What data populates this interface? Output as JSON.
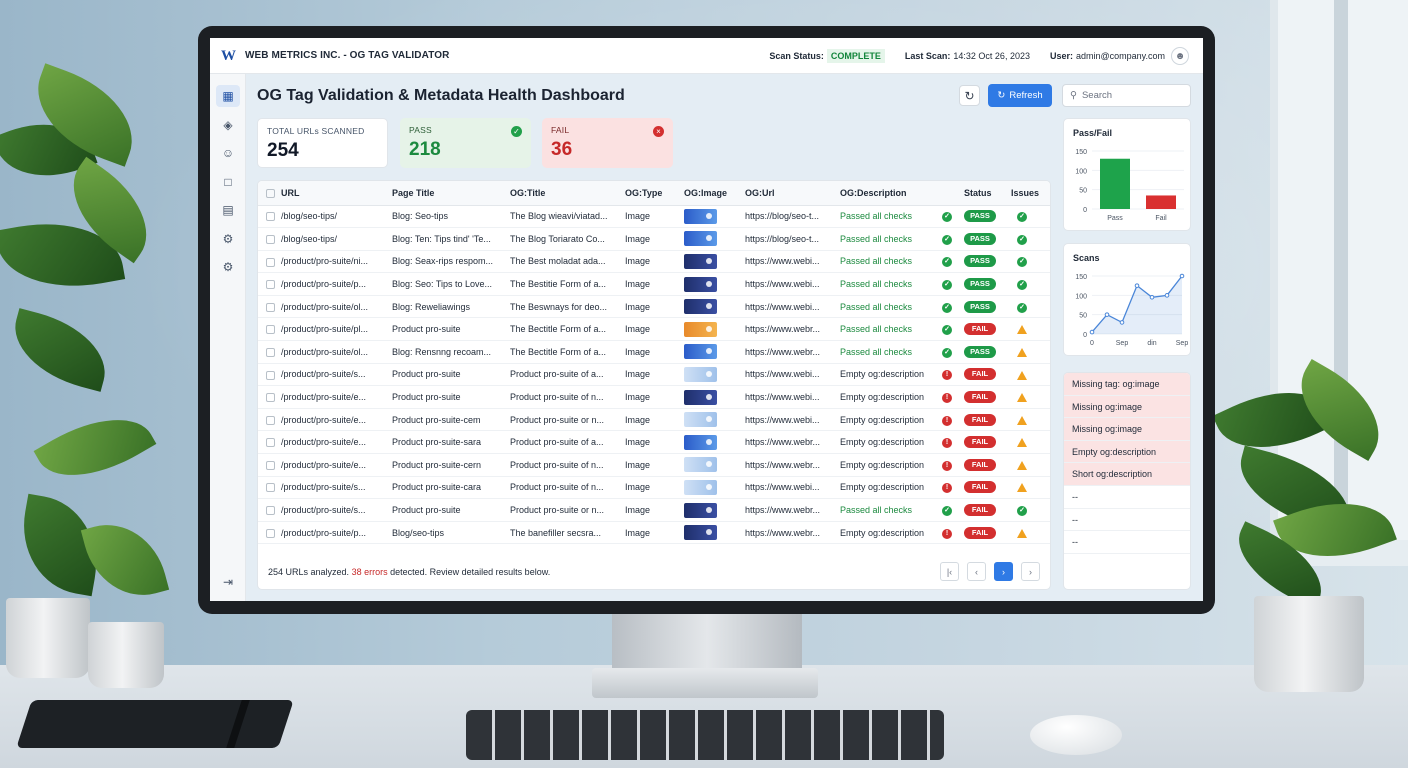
{
  "app": {
    "title": "WEB METRICS INC. - OG TAG VALIDATOR",
    "scan_status_label": "Scan Status:",
    "scan_status_value": "COMPLETE",
    "last_scan_label": "Last Scan:",
    "last_scan_value": "14:32 Oct 26, 2023",
    "user_label": "User:",
    "user_value": "admin@company.com"
  },
  "page": {
    "title": "OG Tag Validation & Metadata Health Dashboard",
    "refresh_label": "Refresh",
    "search_placeholder": "Search"
  },
  "kpis": {
    "total": {
      "label": "TOTAL URLs SCANNED",
      "value": "254"
    },
    "pass": {
      "label": "PASS",
      "value": "218"
    },
    "fail": {
      "label": "FAIL",
      "value": "36"
    }
  },
  "table": {
    "columns": [
      "URL",
      "Page Title",
      "OG:Title",
      "OG:Type",
      "OG:Image",
      "OG:Url",
      "OG:Description",
      "Status",
      "Issues"
    ],
    "rows": [
      {
        "url": "/blog/seo-tips/",
        "page_title": "Blog: Seo-tips",
        "og_title": "The Blog wieavi/viatad...",
        "og_type": "Image",
        "thumb": "blue",
        "og_url": "https://blog/seo-t...",
        "og_desc": "Passed all checks",
        "desc_ok": true,
        "status": "PASS",
        "issue": "ok"
      },
      {
        "url": "/blog/seo-tips/",
        "page_title": "Blog: Ten: Tips tind' 'Te...",
        "og_title": "The Blog Toriarato Co...",
        "og_type": "Image",
        "thumb": "blue",
        "og_url": "https://blog/seo-t...",
        "og_desc": "Passed all checks",
        "desc_ok": true,
        "status": "PASS",
        "issue": "ok"
      },
      {
        "url": "/product/pro-suite/ni...",
        "page_title": "Blog: Seax-rips respom...",
        "og_title": "The Best moladat ada...",
        "og_type": "Image",
        "thumb": "navy",
        "og_url": "https://www.webi...",
        "og_desc": "Passed all checks",
        "desc_ok": true,
        "status": "PASS",
        "issue": "ok"
      },
      {
        "url": "/product/pro-suite/p...",
        "page_title": "Blog: Seo: Tips to Love...",
        "og_title": "The Bestitie Form of a...",
        "og_type": "Image",
        "thumb": "navy",
        "og_url": "https://www.webi...",
        "og_desc": "Passed all checks",
        "desc_ok": true,
        "status": "PASS",
        "issue": "ok"
      },
      {
        "url": "/product/pro-suite/ol...",
        "page_title": "Blog: Reweliawings",
        "og_title": "The Beswnays for deo...",
        "og_type": "Image",
        "thumb": "navy",
        "og_url": "https://www.webi...",
        "og_desc": "Passed all checks",
        "desc_ok": true,
        "status": "PASS",
        "issue": "ok"
      },
      {
        "url": "/product/pro-suite/pl...",
        "page_title": "Product pro-suite",
        "og_title": "The Bectitle Form of a...",
        "og_type": "Image",
        "thumb": "orange",
        "og_url": "https://www.webr...",
        "og_desc": "Passed all checks",
        "desc_ok": true,
        "status": "FAIL",
        "issue": "warn"
      },
      {
        "url": "/product/pro-suite/ol...",
        "page_title": "Blog: Rensnng recoam...",
        "og_title": "The Bectitle Form of a...",
        "og_type": "Image",
        "thumb": "blue",
        "og_url": "https://www.webr...",
        "og_desc": "Passed all checks",
        "desc_ok": true,
        "status": "PASS",
        "issue": "warn"
      },
      {
        "url": "/product/pro-suite/s...",
        "page_title": "Product pro-suite",
        "og_title": "Product pro-suite of a...",
        "og_type": "Image",
        "thumb": "light",
        "og_url": "https://www.webi...",
        "og_desc": "Empty og:description",
        "desc_ok": false,
        "status": "FAIL",
        "issue": "warn"
      },
      {
        "url": "/product/pro-suite/e...",
        "page_title": "Product pro-suite",
        "og_title": "Product pro-suite of n...",
        "og_type": "Image",
        "thumb": "navy",
        "og_url": "https://www.webi...",
        "og_desc": "Empty og:description",
        "desc_ok": false,
        "status": "FAIL",
        "issue": "warn"
      },
      {
        "url": "/product/pro-suite/e...",
        "page_title": "Product pro-suite-cem",
        "og_title": "Product pro-suite or n...",
        "og_type": "Image",
        "thumb": "light",
        "og_url": "https://www.webi...",
        "og_desc": "Empty og:description",
        "desc_ok": false,
        "status": "FAIL",
        "issue": "warn"
      },
      {
        "url": "/product/pro-suite/e...",
        "page_title": "Product pro-suite-sara",
        "og_title": "Product pro-suite of a...",
        "og_type": "Image",
        "thumb": "blue",
        "og_url": "https://www.webr...",
        "og_desc": "Empty og:description",
        "desc_ok": false,
        "status": "FAIL",
        "issue": "warn"
      },
      {
        "url": "/product/pro-suite/e...",
        "page_title": "Product pro-suite-cern",
        "og_title": "Product pro-suite of n...",
        "og_type": "Image",
        "thumb": "light",
        "og_url": "https://www.webr...",
        "og_desc": "Empty og:description",
        "desc_ok": false,
        "status": "FAIL",
        "issue": "warn"
      },
      {
        "url": "/product/pro-suite/s...",
        "page_title": "Product pro-suite-cara",
        "og_title": "Product pro-suite of n...",
        "og_type": "Image",
        "thumb": "light",
        "og_url": "https://www.webi...",
        "og_desc": "Empty og:description",
        "desc_ok": false,
        "status": "FAIL",
        "issue": "warn"
      },
      {
        "url": "/product/pro-suite/s...",
        "page_title": "Product pro-suite",
        "og_title": "Product pro-suite or n...",
        "og_type": "Image",
        "thumb": "navy",
        "og_url": "https://www.webr...",
        "og_desc": "Passed all checks",
        "desc_ok": true,
        "status": "FAIL",
        "issue": "ok"
      },
      {
        "url": "/product/pro-suite/p...",
        "page_title": "Blog/seo-tips",
        "og_title": "The banefiller secsra...",
        "og_type": "Image",
        "thumb": "navy",
        "og_url": "https://www.webr...",
        "og_desc": "Empty og:description",
        "desc_ok": false,
        "status": "FAIL",
        "issue": "warn"
      }
    ]
  },
  "footer": {
    "analyzed": "254 URLs analyzed.",
    "errors": "38 errors",
    "rest": "detected. Review detailed results below."
  },
  "side_issues": [
    "Missing tag: og:image",
    "Missing og:image",
    "Missing og:image",
    "Empty og:description",
    "Short og:description",
    "--",
    "--",
    "--"
  ],
  "chart_data": [
    {
      "type": "bar",
      "title": "Pass/Fail",
      "categories": [
        "Pass",
        "Fail"
      ],
      "values": [
        130,
        35
      ],
      "colors": [
        "#1ea34b",
        "#d93030"
      ],
      "ylim": [
        0,
        150
      ],
      "yticks": [
        0,
        50,
        100,
        150
      ]
    },
    {
      "type": "area",
      "title": "Scans",
      "x_tick_labels": [
        "0",
        "Sep",
        "din",
        "Sep"
      ],
      "values": [
        5,
        50,
        30,
        125,
        95,
        100,
        150
      ],
      "ylim": [
        0,
        150
      ],
      "yticks": [
        0,
        50,
        100,
        150
      ],
      "color": "#4a86d8"
    }
  ],
  "icons": {
    "sidebar": [
      "dashboard-icon",
      "layers-icon",
      "users-icon",
      "wallet-icon",
      "report-icon",
      "settings-icon",
      "gear-icon"
    ],
    "logout": "logout-icon"
  },
  "colors": {
    "accent": "#2f7ae5",
    "pass": "#1e9a48",
    "fail": "#d32f2f",
    "warn": "#f0a11f"
  }
}
